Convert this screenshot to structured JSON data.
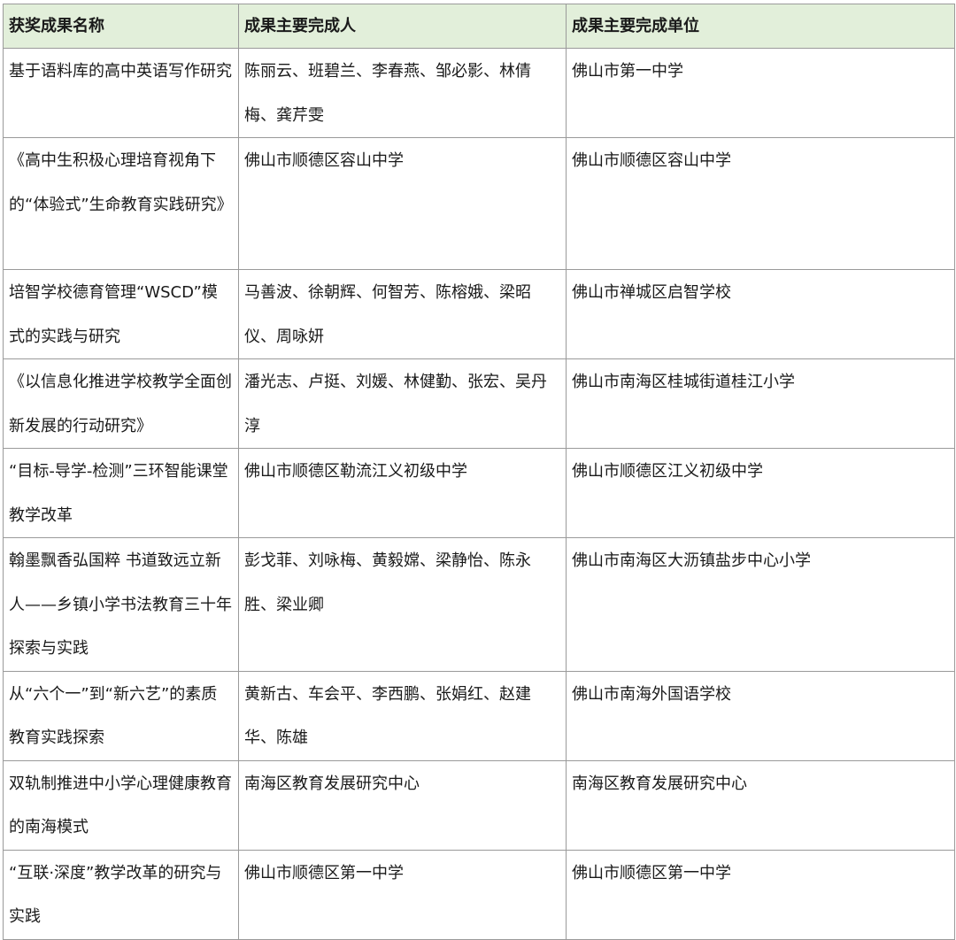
{
  "table": {
    "headers": [
      "获奖成果名称",
      "成果主要完成人",
      "成果主要完成单位"
    ],
    "rows": [
      [
        "基于语料库的高中英语写作研究",
        "陈丽云、班碧兰、李春燕、邹必影、林倩梅、龚芹雯",
        "佛山市第一中学"
      ],
      [
        "《高中生积极心理培育视角下的“体验式”生命教育实践研究》",
        "佛山市顺德区容山中学",
        "佛山市顺德区容山中学"
      ],
      [
        "培智学校德育管理“WSCD”模式的实践与研究",
        "马善波、徐朝辉、何智芳、陈榕娥、梁昭仪、周咏妍",
        "佛山市禅城区启智学校"
      ],
      [
        "《以信息化推进学校教学全面创新发展的行动研究》",
        "潘光志、卢挺、刘媛、林健勤、张宏、吴丹淳",
        "佛山市南海区桂城街道桂江小学"
      ],
      [
        "“目标-导学-检测”三环智能课堂教学改革",
        "佛山市顺德区勒流江义初级中学",
        "佛山市顺德区江义初级中学"
      ],
      [
        "翰墨飘香弘国粹 书道致远立新人——乡镇小学书法教育三十年探索与实践",
        "彭戈菲、刘咏梅、黄毅嫦、梁静怡、陈永胜、梁业卿",
        "佛山市南海区大沥镇盐步中心小学"
      ],
      [
        "从“六个一”到“新六艺”的素质教育实践探索",
        "黄新古、车会平、李西鹏、张娟红、赵建华、陈雄",
        "佛山市南海外国语学校"
      ],
      [
        "双轨制推进中小学心理健康教育的南海模式",
        "南海区教育发展研究中心",
        "南海区教育发展研究中心"
      ],
      [
        "“互联·深度”教学改革的研究与实践",
        "佛山市顺德区第一中学",
        "佛山市顺德区第一中学"
      ]
    ]
  },
  "colors": {
    "header_bg": "#e2efda",
    "border": "#9a9a9a",
    "text": "#1a1a1a"
  }
}
